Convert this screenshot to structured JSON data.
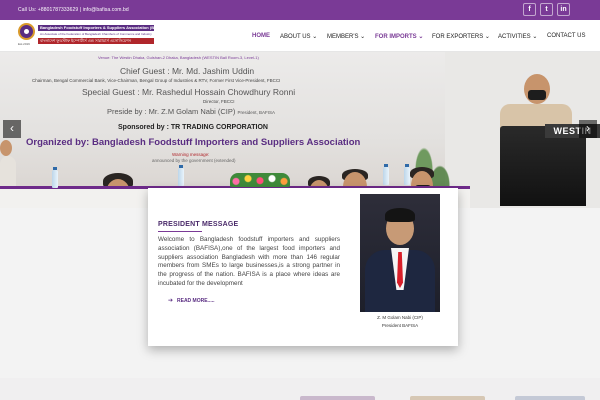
{
  "topbar": {
    "call_label": "Call Us",
    "phone": "+8801787333629",
    "email": "info@bafisa.com.bd",
    "social": [
      {
        "icon": "facebook-icon",
        "glyph": "f"
      },
      {
        "icon": "twitter-icon",
        "glyph": "t"
      },
      {
        "icon": "linkedin-icon",
        "glyph": "in"
      }
    ]
  },
  "logo": {
    "name": "Bangladesh Foodstuff Importers & Suppliers Association (BAFISA)",
    "bangla_name": "বাংলাদেশ ফুডস্টাফ ইম্পোর্টার্স এন্ড সাপ্লায়ার্স এসোসিয়েশন",
    "affiliation": "An Associate of the Federation of Bangladesh Chambers of Commerce and Industry",
    "estd": "Est.2019"
  },
  "nav": {
    "items": [
      {
        "label": "HOME",
        "dropdown": false,
        "active": true
      },
      {
        "label": "ABOUT US",
        "dropdown": true,
        "active": false
      },
      {
        "label": "MEMBER'S",
        "dropdown": true,
        "active": false
      },
      {
        "label": "FOR IMPORTS",
        "dropdown": true,
        "active": false
      },
      {
        "label": "FOR EXPORTERS",
        "dropdown": true,
        "active": false
      },
      {
        "label": "ACTIVITIES",
        "dropdown": true,
        "active": false
      },
      {
        "label": "CONTACT US",
        "dropdown": false,
        "active": false
      }
    ]
  },
  "hero": {
    "venue": "Venue: The Westin Dhaka, Gulshan-2 Dhaka, Bangladesh (WESTIN Ball Room-3, Level-1)",
    "chief_guest": "Chief Guest : Mr. Md. Jashim Uddin",
    "chief_guest_title": "Chairman, Bengal Commercial Bank, Vice-Chairman, Bengal Group of Industries & RTV, Former First Vice-President, FBCCI",
    "special_guest": "Special Guest : Mr. Rashedul Hossain Chowdhury Ronni",
    "special_guest_title": "Director, FBCCI",
    "preside": "Preside by : Mr. Z.M Golam Nabi (CIP)",
    "preside_title": "President, BAFISA",
    "sponsor": "Sponsored by : TR TRADING CORPORATION",
    "organized": "Organized by: Bangladesh Foodstuff Importers and Suppliers Association",
    "warning": "Warning message:",
    "warning_sub": "announced by the government (extended)",
    "hotel_sign": "WESTIN",
    "prev_glyph": "‹",
    "next_glyph": "›"
  },
  "president": {
    "heading": "PRESIDENT MESSAGE",
    "message": "Welcome to Bangladesh foodstuff importers and suppliers association (BAFISA),one of the largest food importers and suppliers association Bangladesh with more than 146 regular members from SMEs to large businesses,is a strong partner in the progress of the nation. BAFISA is a place where ideas are incubated for the development",
    "read_more": "READ MORE.....",
    "name": "Z. M Golam Nabi (CIP)",
    "role": "President BAFISA"
  },
  "colors": {
    "brand_purple": "#7a3a96",
    "accent_red": "#b0262b"
  }
}
